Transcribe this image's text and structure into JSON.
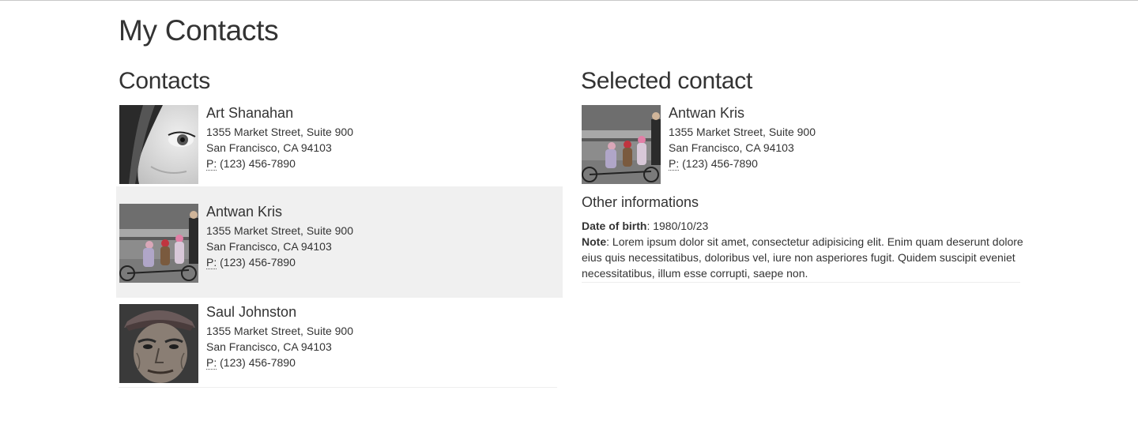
{
  "page": {
    "title": "My Contacts"
  },
  "contacts_panel": {
    "heading": "Contacts",
    "items": [
      {
        "name": "Art Shanahan",
        "address_line1": "1355 Market Street, Suite 900",
        "address_line2": "San Francisco, CA 94103",
        "phone_label": "P:",
        "phone": "(123) 456-7890",
        "selected": false,
        "photo": "girl-eye-photo"
      },
      {
        "name": "Antwan Kris",
        "address_line1": "1355 Market Street, Suite 900",
        "address_line2": "San Francisco, CA 94103",
        "phone_label": "P:",
        "phone": "(123) 456-7890",
        "selected": true,
        "photo": "children-bicycle-photo"
      },
      {
        "name": "Saul Johnston",
        "address_line1": "1355 Market Street, Suite 900",
        "address_line2": "San Francisco, CA 94103",
        "phone_label": "P:",
        "phone": "(123) 456-7890",
        "selected": false,
        "photo": "old-man-cap-photo"
      }
    ]
  },
  "selected_panel": {
    "heading": "Selected contact",
    "contact": {
      "name": "Antwan Kris",
      "address_line1": "1355 Market Street, Suite 900",
      "address_line2": "San Francisco, CA 94103",
      "phone_label": "P:",
      "phone": "(123) 456-7890",
      "photo": "children-bicycle-photo"
    },
    "other_heading": "Other informations",
    "dob_label": "Date of birth",
    "dob_value": ": 1980/10/23",
    "note_label": "Note",
    "note_value": ": Lorem ipsum dolor sit amet, consectetur adipisicing elit. Enim quam deserunt dolore eius quis necessitatibus, doloribus vel, iure non asperiores fugit. Quidem suscipit eveniet necessitatibus, illum esse corrupti, saepe non."
  },
  "colors": {
    "text": "#333333",
    "selected_row_bg": "#f0f0f0",
    "divider": "#eeeeee"
  }
}
